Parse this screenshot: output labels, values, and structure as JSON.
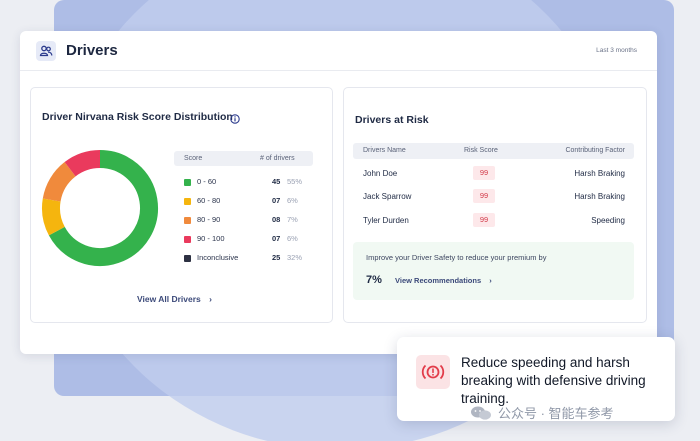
{
  "header": {
    "title": "Drivers",
    "period": "Last 3 months",
    "icon": "users-icon"
  },
  "distribution": {
    "title": "Driver Nirvana Risk Score Distribution",
    "col_score": "Score",
    "col_drivers": "# of drivers",
    "rows": [
      {
        "label": "0 - 60",
        "count": "45",
        "pct": "55%",
        "color": "#34b24c",
        "value": 45
      },
      {
        "label": "60 - 80",
        "count": "07",
        "pct": "6%",
        "color": "#f5b50e",
        "value": 7
      },
      {
        "label": "80 - 90",
        "count": "08",
        "pct": "7%",
        "color": "#f08a3c",
        "value": 8
      },
      {
        "label": "90 - 100",
        "count": "07",
        "pct": "6%",
        "color": "#ea3a5d",
        "value": 7
      },
      {
        "label": "Inconclusive",
        "count": "25",
        "pct": "32%",
        "color": "#2d3142",
        "value": 0
      }
    ],
    "view_all": "View All Drivers",
    "view_all_chevron": "›"
  },
  "at_risk": {
    "title": "Drivers at Risk",
    "col_name": "Drivers Name",
    "col_score": "Risk Score",
    "col_factor": "Contributing Factor",
    "rows": [
      {
        "name": "John Doe",
        "score": "99",
        "factor": "Harsh Braking"
      },
      {
        "name": "Jack Sparrow",
        "score": "99",
        "factor": "Harsh Braking"
      },
      {
        "name": "Tyler Durden",
        "score": "99",
        "factor": "Speeding"
      }
    ],
    "promo_text": "Improve your Driver Safety to reduce your premium by",
    "promo_pct": "7%",
    "promo_link": "View Recommendations",
    "promo_chevron": "›"
  },
  "toast": {
    "text": "Reduce speeding and harsh breaking with defensive driving training.",
    "icon": "brake-warning-icon"
  },
  "watermark": {
    "text": "公众号 · 智能车参考"
  }
}
